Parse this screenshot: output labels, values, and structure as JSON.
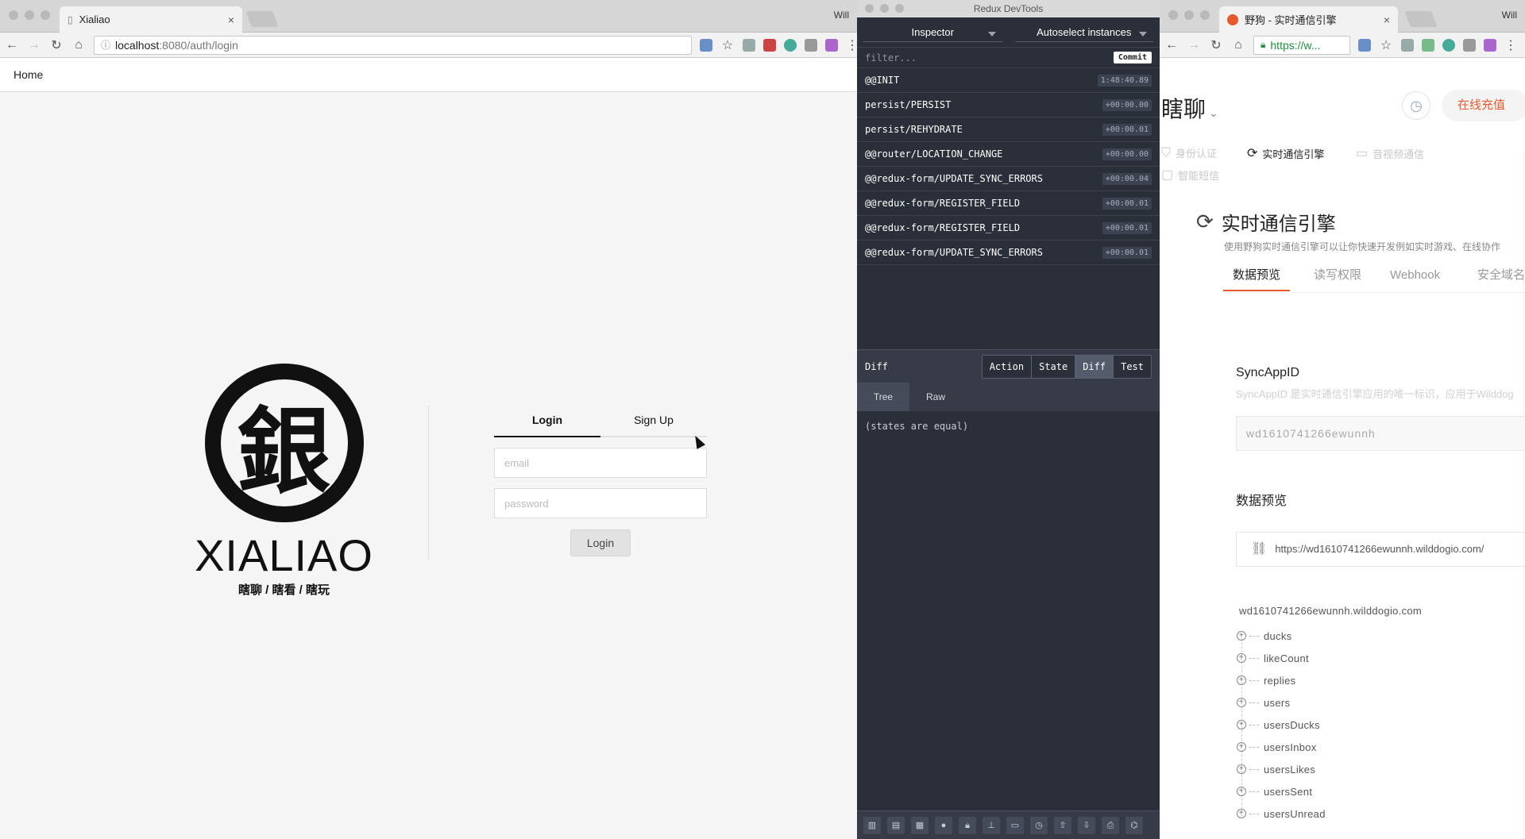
{
  "left_window": {
    "tab_title": "Xialiao",
    "tab_close": "×",
    "profile": "Will",
    "address_host": "localhost",
    "address_rest": ":8080/auth/login",
    "nav_home": "Home",
    "brand_glyph": "銀",
    "brand_wordmark": "XIALIAO",
    "brand_tagline": "瞎聊 / 瞎看 / 瞎玩",
    "auth_tabs": [
      {
        "label": "Login",
        "active": true
      },
      {
        "label": "Sign Up",
        "active": false
      }
    ],
    "email_placeholder": "email",
    "password_placeholder": "password",
    "login_button": "Login"
  },
  "devtools": {
    "window_title": "Redux DevTools",
    "monitor_select": "Inspector",
    "instance_select": "Autoselect instances",
    "filter_placeholder": "filter...",
    "commit_label": "Commit",
    "actions": [
      {
        "name": "@@INIT",
        "time": "1:48:40.89"
      },
      {
        "name": "persist/PERSIST",
        "time": "+00:00.00"
      },
      {
        "name": "persist/REHYDRATE",
        "time": "+00:00.01"
      },
      {
        "name": "@@router/LOCATION_CHANGE",
        "time": "+00:00.00"
      },
      {
        "name": "@@redux-form/UPDATE_SYNC_ERRORS",
        "time": "+00:00.04"
      },
      {
        "name": "@@redux-form/REGISTER_FIELD",
        "time": "+00:00.01"
      },
      {
        "name": "@@redux-form/REGISTER_FIELD",
        "time": "+00:00.01"
      },
      {
        "name": "@@redux-form/UPDATE_SYNC_ERRORS",
        "time": "+00:00.01"
      }
    ],
    "panel_label": "Diff",
    "panel_tabs": [
      {
        "label": "Action",
        "active": false
      },
      {
        "label": "State",
        "active": false
      },
      {
        "label": "Diff",
        "active": true
      },
      {
        "label": "Test",
        "active": false
      }
    ],
    "view_tabs": [
      {
        "label": "Tree",
        "active": true
      },
      {
        "label": "Raw",
        "active": false
      }
    ],
    "diff_message": "(states are equal)"
  },
  "right_window": {
    "tab_title": "野狗 - 实时通信引擎",
    "tab_close": "×",
    "profile": "Will",
    "address": "https://w...",
    "app_name": "瞎聊",
    "recharge_button": "在线充值",
    "product_nav": [
      {
        "label": "身份认证",
        "active": false
      },
      {
        "label": "实时通信引擎",
        "active": true
      },
      {
        "label": "音视频通信",
        "active": false
      },
      {
        "label": "智能短信",
        "active": false
      }
    ],
    "engine_title": "实时通信引擎",
    "engine_desc": "使用野狗实时通信引擎可以让你快速开发例如实时游戏、在线协作",
    "tabs": [
      {
        "label": "数据预览",
        "active": true
      },
      {
        "label": "读写权限",
        "active": false
      },
      {
        "label": "Webhook",
        "active": false
      },
      {
        "label": "安全域名",
        "active": false
      }
    ],
    "syncappid_title": "SyncAppID",
    "syncappid_desc": "SyncAppID 是实时通信引擎应用的唯一标识，应用于Wilddog",
    "syncappid_value": "wd1610741266ewunnh",
    "preview_title": "数据预览",
    "preview_url": "https://wd1610741266ewunnh.wilddogio.com/",
    "db_root": "wd1610741266ewunnh.wilddogio.com",
    "tree_nodes": [
      "ducks",
      "likeCount",
      "replies",
      "users",
      "usersDucks",
      "usersInbox",
      "usersLikes",
      "usersSent",
      "usersUnread"
    ]
  }
}
